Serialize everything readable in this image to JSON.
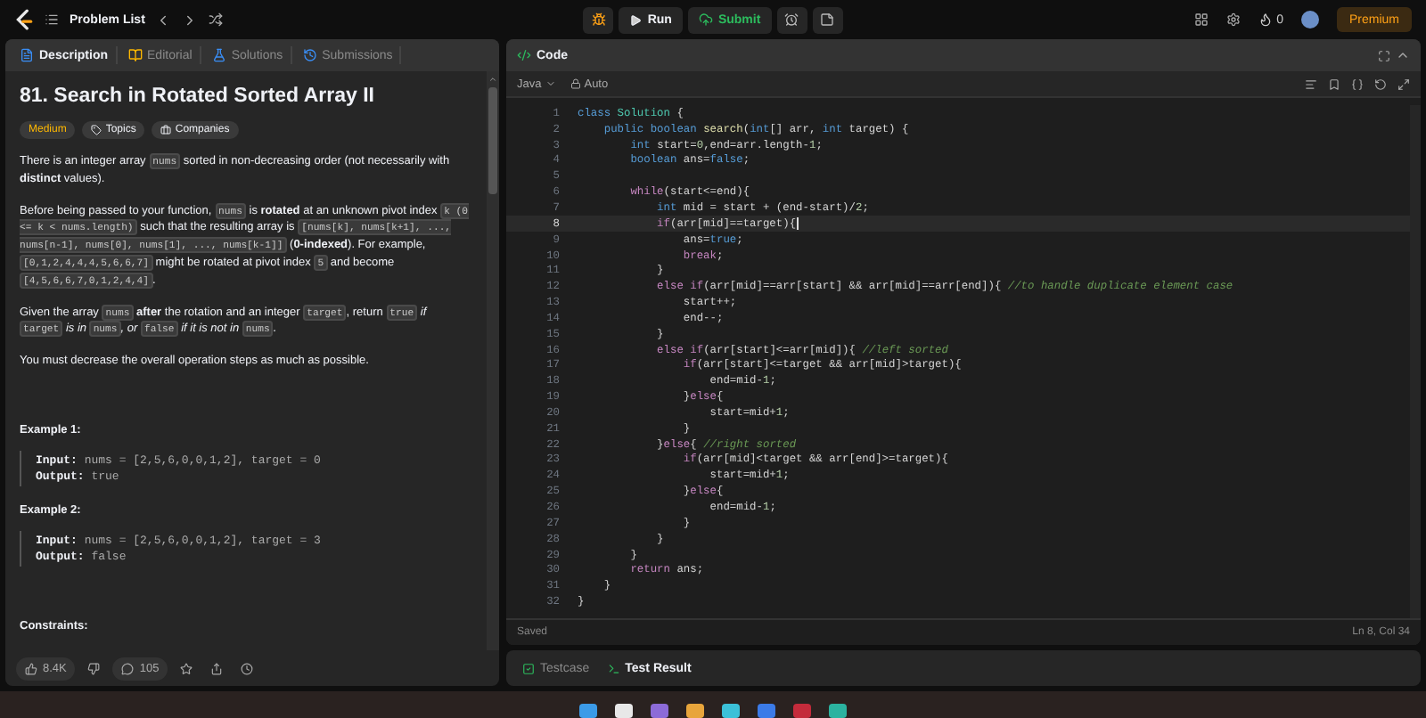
{
  "nav": {
    "problem_list": "Problem List",
    "run": "Run",
    "submit": "Submit",
    "streak": "0",
    "premium": "Premium"
  },
  "left_tabs": [
    {
      "label": "Description",
      "selected": true
    },
    {
      "label": "Editorial",
      "selected": false
    },
    {
      "label": "Solutions",
      "selected": false
    },
    {
      "label": "Submissions",
      "selected": false
    }
  ],
  "problem": {
    "title": "81. Search in Rotated Sorted Array II",
    "difficulty": "Medium",
    "tags": [
      "Topics",
      "Companies"
    ],
    "paragraphs": [
      [
        {
          "kind": "plain",
          "text": "There is an integer array "
        },
        {
          "kind": "code",
          "text": "nums"
        },
        {
          "kind": "plain",
          "text": " sorted in non-decreasing order (not necessarily with "
        },
        {
          "kind": "bold",
          "text": "distinct"
        },
        {
          "kind": "plain",
          "text": " values)."
        }
      ],
      [
        {
          "kind": "plain",
          "text": "Before being passed to your function, "
        },
        {
          "kind": "code",
          "text": "nums"
        },
        {
          "kind": "plain",
          "text": " is "
        },
        {
          "kind": "bold",
          "text": "rotated"
        },
        {
          "kind": "plain",
          "text": " at an unknown pivot index "
        },
        {
          "kind": "code",
          "text": "k (0 <= k < nums.length)"
        },
        {
          "kind": "plain",
          "text": " such that the resulting array is "
        },
        {
          "kind": "code",
          "text": "[nums[k], nums[k+1], ..., nums[n-1], nums[0], nums[1], ..., nums[k-1]]"
        },
        {
          "kind": "plain",
          "text": " ("
        },
        {
          "kind": "bold",
          "text": "0-indexed"
        },
        {
          "kind": "plain",
          "text": "). For example, "
        },
        {
          "kind": "code",
          "text": "[0,1,2,4,4,4,5,6,6,7]"
        },
        {
          "kind": "plain",
          "text": " might be rotated at pivot index "
        },
        {
          "kind": "code",
          "text": "5"
        },
        {
          "kind": "plain",
          "text": " and become "
        },
        {
          "kind": "code",
          "text": "[4,5,6,6,7,0,1,2,4,4]"
        },
        {
          "kind": "plain",
          "text": "."
        }
      ],
      [
        {
          "kind": "plain",
          "text": "Given the array "
        },
        {
          "kind": "code",
          "text": "nums"
        },
        {
          "kind": "bold",
          "text": " after"
        },
        {
          "kind": "plain",
          "text": " the rotation and an integer "
        },
        {
          "kind": "code",
          "text": "target"
        },
        {
          "kind": "plain",
          "text": ", return "
        },
        {
          "kind": "code",
          "text": "true"
        },
        {
          "kind": "italic",
          "text": " if "
        },
        {
          "kind": "code",
          "text": "target"
        },
        {
          "kind": "italic",
          "text": " is in "
        },
        {
          "kind": "code",
          "text": "nums"
        },
        {
          "kind": "italic",
          "text": ", or "
        },
        {
          "kind": "code",
          "text": "false"
        },
        {
          "kind": "italic",
          "text": " if it is not in "
        },
        {
          "kind": "code",
          "text": "nums"
        },
        {
          "kind": "italic",
          "text": "."
        }
      ],
      [
        {
          "kind": "plain",
          "text": "You must decrease the overall operation steps as much as possible."
        }
      ]
    ],
    "examples": [
      {
        "heading": "Example 1:",
        "input_label": "Input:",
        "input": "nums = [2,5,6,0,0,1,2], target = 0",
        "output_label": "Output:",
        "output": "true"
      },
      {
        "heading": "Example 2:",
        "input_label": "Input:",
        "input": "nums = [2,5,6,0,0,1,2], target = 3",
        "output_label": "Output:",
        "output": "false"
      }
    ],
    "constraints_heading": "Constraints:"
  },
  "footer": {
    "likes": "8.4K",
    "comments": "105"
  },
  "editor": {
    "title": "Code",
    "language": "Java",
    "mode": "Auto",
    "status": "Saved",
    "cursor": "Ln 8, Col 34",
    "lines": [
      {
        "number": "1",
        "active": false,
        "tokens": [
          {
            "kind": "kw",
            "text": "class "
          },
          {
            "kind": "type",
            "text": "Solution"
          },
          {
            "kind": "plain",
            "text": " {"
          }
        ]
      },
      {
        "number": "2",
        "active": false,
        "tokens": [
          {
            "kind": "kw",
            "text": "    public boolean "
          },
          {
            "kind": "fn",
            "text": "search"
          },
          {
            "kind": "plain",
            "text": "("
          },
          {
            "kind": "kw",
            "text": "int"
          },
          {
            "kind": "plain",
            "text": "[] arr, "
          },
          {
            "kind": "kw",
            "text": "int"
          },
          {
            "kind": "plain",
            "text": " target) {"
          }
        ]
      },
      {
        "number": "3",
        "active": false,
        "tokens": [
          {
            "kind": "kw",
            "text": "        int"
          },
          {
            "kind": "plain",
            "text": " start="
          },
          {
            "kind": "num",
            "text": "0"
          },
          {
            "kind": "plain",
            "text": ",end=arr.length-"
          },
          {
            "kind": "num",
            "text": "1"
          },
          {
            "kind": "plain",
            "text": ";"
          }
        ]
      },
      {
        "number": "4",
        "active": false,
        "tokens": [
          {
            "kind": "kw",
            "text": "        boolean"
          },
          {
            "kind": "plain",
            "text": " ans="
          },
          {
            "kind": "kw",
            "text": "false"
          },
          {
            "kind": "plain",
            "text": ";"
          }
        ]
      },
      {
        "number": "5",
        "active": false
      },
      {
        "number": "6",
        "active": false,
        "tokens": [
          {
            "kind": "ctl",
            "text": "        while"
          },
          {
            "kind": "plain",
            "text": "(start<=end){"
          }
        ]
      },
      {
        "number": "7",
        "active": false,
        "tokens": [
          {
            "kind": "kw",
            "text": "            int"
          },
          {
            "kind": "plain",
            "text": " mid = start + (end-start)/"
          },
          {
            "kind": "num",
            "text": "2"
          },
          {
            "kind": "plain",
            "text": ";"
          }
        ]
      },
      {
        "number": "8",
        "active": true,
        "tokens": [
          {
            "kind": "ctl",
            "text": "            if"
          },
          {
            "kind": "plain",
            "text": "(arr[mid]==target){"
          }
        ]
      },
      {
        "number": "9",
        "active": false,
        "tokens": [
          {
            "kind": "plain",
            "text": "                ans="
          },
          {
            "kind": "kw",
            "text": "true"
          },
          {
            "kind": "plain",
            "text": ";"
          }
        ]
      },
      {
        "number": "10",
        "active": false,
        "tokens": [
          {
            "kind": "ctl",
            "text": "                break"
          },
          {
            "kind": "plain",
            "text": ";"
          }
        ]
      },
      {
        "number": "11",
        "active": false,
        "tokens": [
          {
            "kind": "plain",
            "text": "            }"
          }
        ]
      },
      {
        "number": "12",
        "active": false,
        "tokens": [
          {
            "kind": "ctl",
            "text": "            else if"
          },
          {
            "kind": "plain",
            "text": "(arr[mid]==arr[start] && arr[mid]==arr[end]){ "
          },
          {
            "kind": "comment",
            "text": "//to handle duplicate element case"
          }
        ]
      },
      {
        "number": "13",
        "active": false,
        "tokens": [
          {
            "kind": "plain",
            "text": "                start++;"
          }
        ]
      },
      {
        "number": "14",
        "active": false,
        "tokens": [
          {
            "kind": "plain",
            "text": "                end--;"
          }
        ]
      },
      {
        "number": "15",
        "active": false,
        "tokens": [
          {
            "kind": "plain",
            "text": "            }"
          }
        ]
      },
      {
        "number": "16",
        "active": false,
        "tokens": [
          {
            "kind": "ctl",
            "text": "            else if"
          },
          {
            "kind": "plain",
            "text": "(arr[start]<=arr[mid]){ "
          },
          {
            "kind": "comment",
            "text": "//left sorted"
          }
        ]
      },
      {
        "number": "17",
        "active": false,
        "tokens": [
          {
            "kind": "ctl",
            "text": "                if"
          },
          {
            "kind": "plain",
            "text": "(arr[start]<=target && arr[mid]>target){"
          }
        ]
      },
      {
        "number": "18",
        "active": false,
        "tokens": [
          {
            "kind": "plain",
            "text": "                    end=mid-"
          },
          {
            "kind": "num",
            "text": "1"
          },
          {
            "kind": "plain",
            "text": ";"
          }
        ]
      },
      {
        "number": "19",
        "active": false,
        "tokens": [
          {
            "kind": "plain",
            "text": "                }"
          },
          {
            "kind": "ctl",
            "text": "else"
          },
          {
            "kind": "plain",
            "text": "{"
          }
        ]
      },
      {
        "number": "20",
        "active": false,
        "tokens": [
          {
            "kind": "plain",
            "text": "                    start=mid+"
          },
          {
            "kind": "num",
            "text": "1"
          },
          {
            "kind": "plain",
            "text": ";"
          }
        ]
      },
      {
        "number": "21",
        "active": false,
        "tokens": [
          {
            "kind": "plain",
            "text": "                }"
          }
        ]
      },
      {
        "number": "22",
        "active": false,
        "tokens": [
          {
            "kind": "plain",
            "text": "            }"
          },
          {
            "kind": "ctl",
            "text": "else"
          },
          {
            "kind": "plain",
            "text": "{ "
          },
          {
            "kind": "comment",
            "text": "//right sorted"
          }
        ]
      },
      {
        "number": "23",
        "active": false,
        "tokens": [
          {
            "kind": "ctl",
            "text": "                if"
          },
          {
            "kind": "plain",
            "text": "(arr[mid]<target && arr[end]>=target){"
          }
        ]
      },
      {
        "number": "24",
        "active": false,
        "tokens": [
          {
            "kind": "plain",
            "text": "                    start=mid+"
          },
          {
            "kind": "num",
            "text": "1"
          },
          {
            "kind": "plain",
            "text": ";"
          }
        ]
      },
      {
        "number": "25",
        "active": false,
        "tokens": [
          {
            "kind": "plain",
            "text": "                }"
          },
          {
            "kind": "ctl",
            "text": "else"
          },
          {
            "kind": "plain",
            "text": "{"
          }
        ]
      },
      {
        "number": "26",
        "active": false,
        "tokens": [
          {
            "kind": "plain",
            "text": "                    end=mid-"
          },
          {
            "kind": "num",
            "text": "1"
          },
          {
            "kind": "plain",
            "text": ";"
          }
        ]
      },
      {
        "number": "27",
        "active": false,
        "tokens": [
          {
            "kind": "plain",
            "text": "                }"
          }
        ]
      },
      {
        "number": "28",
        "active": false,
        "tokens": [
          {
            "kind": "plain",
            "text": "            }"
          }
        ]
      },
      {
        "number": "29",
        "active": false,
        "tokens": [
          {
            "kind": "plain",
            "text": "        }"
          }
        ]
      },
      {
        "number": "30",
        "active": false,
        "tokens": [
          {
            "kind": "ctl",
            "text": "        return"
          },
          {
            "kind": "plain",
            "text": " ans;"
          }
        ]
      },
      {
        "number": "31",
        "active": false,
        "tokens": [
          {
            "kind": "plain",
            "text": "    }"
          }
        ]
      },
      {
        "number": "32",
        "active": false,
        "tokens": [
          {
            "kind": "plain",
            "text": "}"
          }
        ]
      }
    ]
  },
  "bottom_tabs": [
    {
      "label": "Testcase",
      "selected": false
    },
    {
      "label": "Test Result",
      "selected": true
    }
  ]
}
